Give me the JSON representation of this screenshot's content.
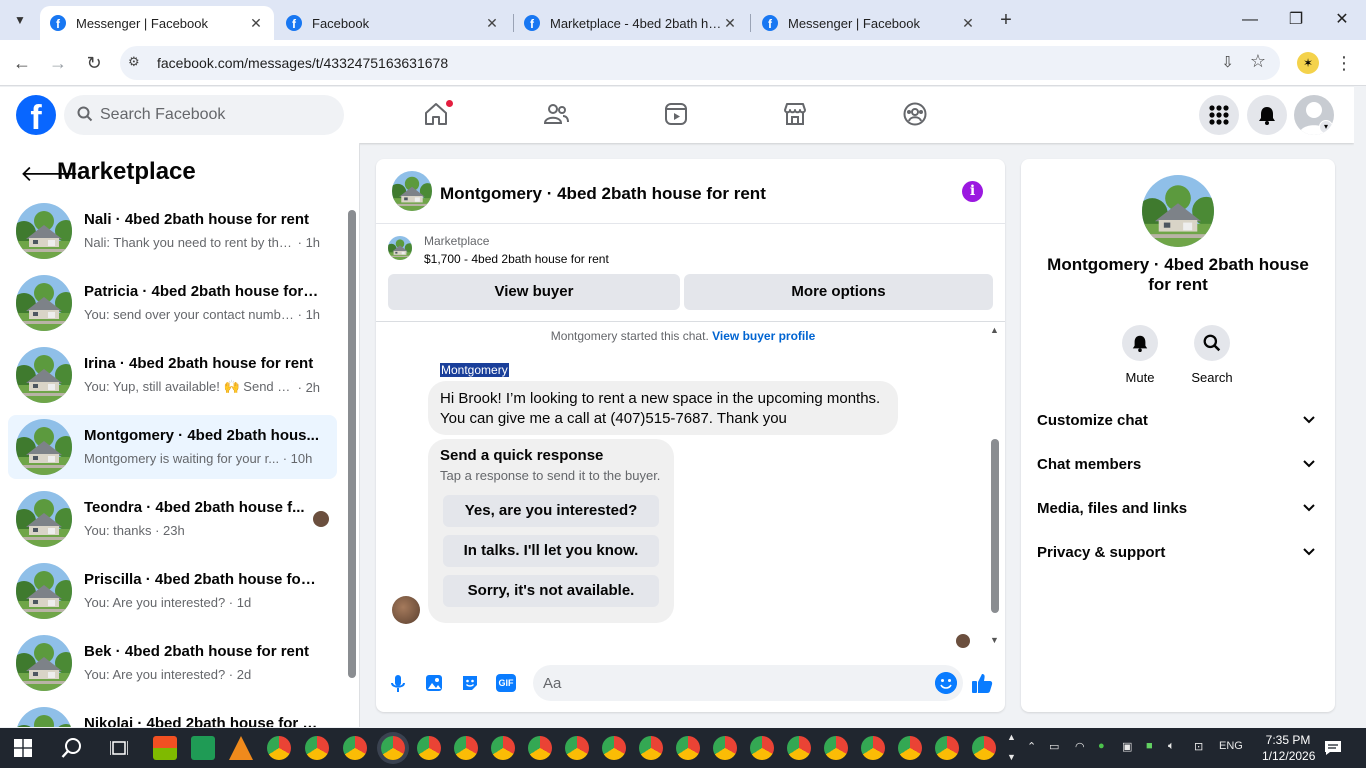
{
  "browser": {
    "tabs": [
      {
        "title": "Messenger | Facebook",
        "active": true
      },
      {
        "title": "Facebook",
        "active": false
      },
      {
        "title": "Marketplace - 4bed 2bath hous",
        "active": false
      },
      {
        "title": "Messenger | Facebook",
        "active": false
      }
    ],
    "url": "facebook.com/messages/t/4332475163631678",
    "new_tab_label": "+"
  },
  "fb": {
    "search_placeholder": "Search Facebook",
    "accent": "#0866ff",
    "nav_icons": [
      "home-icon",
      "friends-icon",
      "watch-icon",
      "marketplace-icon",
      "groups-icon"
    ]
  },
  "sidebar": {
    "title": "Marketplace",
    "chats": [
      {
        "name": "Nali · 4bed 2bath house for rent",
        "snippet": "Nali: Thank you need to rent by the...",
        "time": "1h",
        "selected": false
      },
      {
        "name": "Patricia · 4bed 2bath house for r...",
        "snippet": "You: send over your contact numbe...",
        "time": "1h",
        "selected": false
      },
      {
        "name": "Irina · 4bed 2bath house for rent",
        "snippet": "You: Yup, still available! 🙌 Send ov...",
        "time": "2h",
        "selected": false
      },
      {
        "name": "Montgomery · 4bed 2bath hous...",
        "snippet": "Montgomery is waiting for your r...",
        "time": "10h",
        "selected": true
      },
      {
        "name": "Teondra · 4bed 2bath house f...",
        "snippet": "You: thanks",
        "time": "23h",
        "selected": false
      },
      {
        "name": "Priscilla · 4bed 2bath house for r...",
        "snippet": "You: Are you interested?",
        "time": "1d",
        "selected": false
      },
      {
        "name": "Bek · 4bed 2bath house for rent",
        "snippet": "You: Are you interested?",
        "time": "2d",
        "selected": false
      },
      {
        "name": "Nikolai · 4bed 2bath house for r...",
        "snippet": "",
        "time": "",
        "selected": false
      }
    ]
  },
  "conversation": {
    "title": "Montgomery · 4bed 2bath house for rent",
    "marketplace_label": "Marketplace",
    "listing": "$1,700 - 4bed 2bath house for rent",
    "view_buyer": "View buyer",
    "more_options": "More options",
    "started_text": "Montgomery started this chat.",
    "view_buyer_profile": "View buyer profile",
    "sender_name": "Montgomery",
    "message_line1": "Hi Brook! I’m looking to rent a new space in the upcoming months.",
    "message_line2": "You can give me a call at (407)515-7687. Thank you",
    "quick_title": "Send a quick response",
    "quick_subtitle": "Tap a response to send it to the buyer.",
    "quick_responses": [
      "Yes, are you interested?",
      "In talks. I'll let you know.",
      "Sorry, it's not available."
    ],
    "composer_placeholder": "Aa"
  },
  "details": {
    "name": "Montgomery · 4bed 2bath house for rent",
    "mute_label": "Mute",
    "search_label": "Search",
    "sections": [
      "Customize chat",
      "Chat members",
      "Media, files and links",
      "Privacy & support"
    ]
  },
  "taskbar": {
    "language": "ENG",
    "time": "7:35 PM",
    "date": "1/12/2026"
  }
}
